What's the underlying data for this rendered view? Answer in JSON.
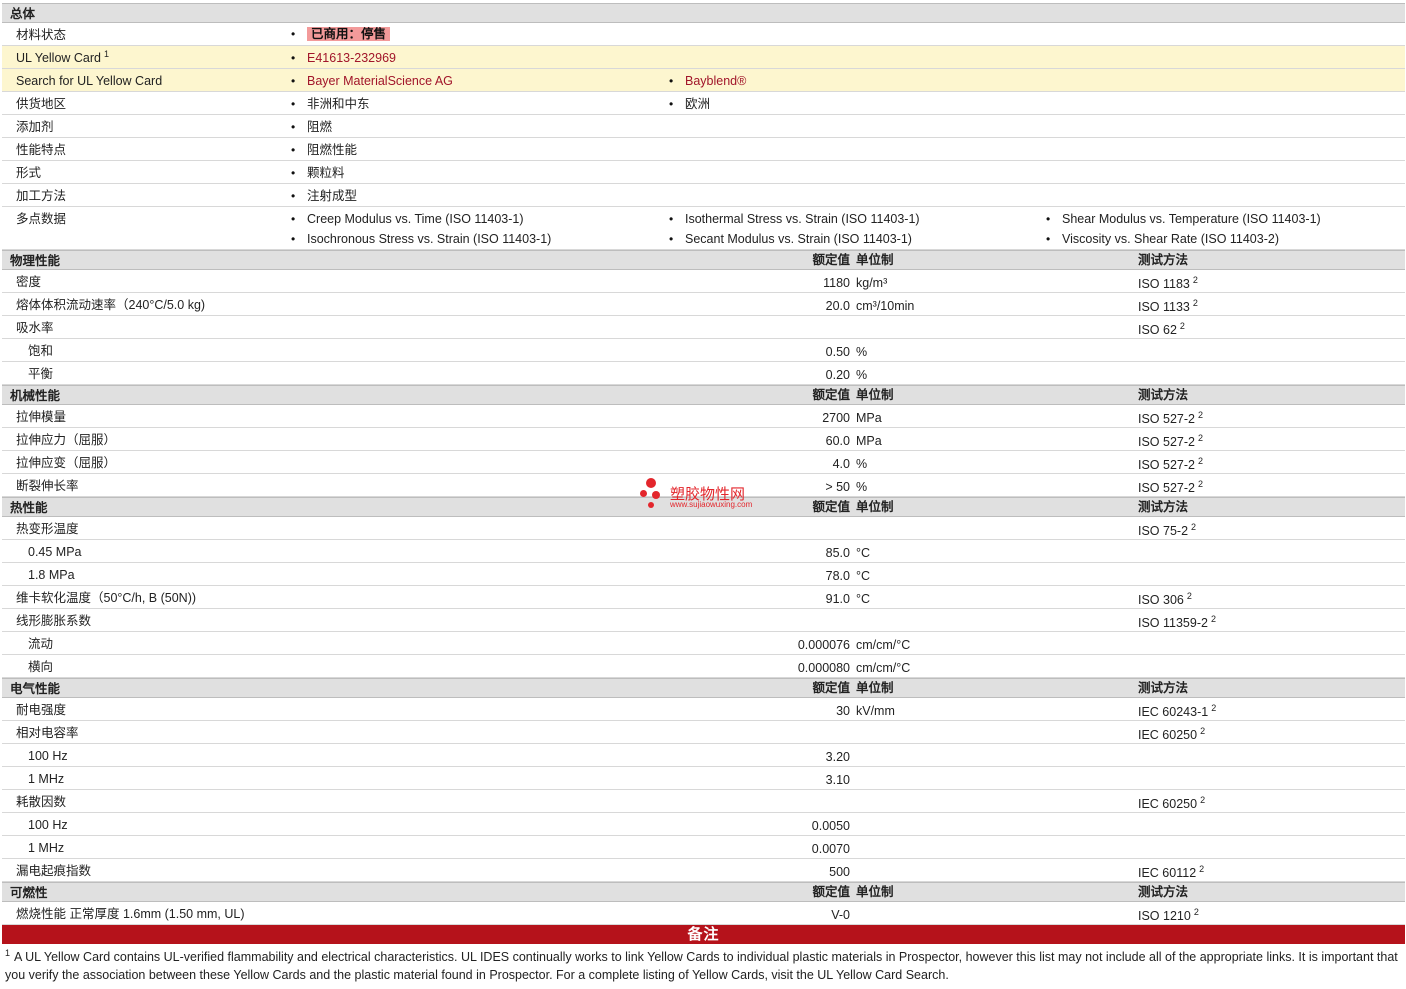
{
  "general": {
    "header": "总体",
    "material_status_label": "材料状态",
    "material_status_value": "已商用：停售",
    "ul_card_label": "UL Yellow Card",
    "ul_card_sup": "1",
    "ul_card_value": "E41613-232969",
    "search_label": "Search for UL Yellow Card",
    "search_links": [
      "Bayer MaterialScience AG",
      "Bayblend®"
    ],
    "supply_label": "供货地区",
    "supply_values": [
      "非洲和中东",
      "欧洲"
    ],
    "additive_label": "添加剂",
    "additive_value": "阻燃",
    "features_label": "性能特点",
    "features_value": "阻燃性能",
    "form_label": "形式",
    "form_value": "颗粒料",
    "processing_label": "加工方法",
    "processing_value": "注射成型",
    "multipoint_label": "多点数据",
    "multipoint_values": [
      "Creep Modulus vs. Time (ISO 11403-1)",
      "Isothermal Stress vs. Strain (ISO 11403-1)",
      "Shear Modulus vs. Temperature (ISO 11403-1)",
      "Isochronous Stress vs. Strain (ISO 11403-1)",
      "Secant Modulus vs. Strain (ISO 11403-1)",
      "Viscosity vs. Shear Rate (ISO 11403-2)"
    ]
  },
  "headers": {
    "value": "额定值",
    "unit": "单位制",
    "test": "测试方法"
  },
  "physical": {
    "title": "物理性能",
    "rows": [
      {
        "label": "密度",
        "value": "1180",
        "unit": "kg/m³",
        "test": "ISO 1183",
        "sup": "2"
      },
      {
        "label": "熔体体积流动速率（240°C/5.0 kg)",
        "value": "20.0",
        "unit": "cm³/10min",
        "test": "ISO 1133",
        "sup": "2"
      },
      {
        "label": "吸水率",
        "value": "",
        "unit": "",
        "test": "ISO 62",
        "sup": "2"
      },
      {
        "label": "饱和",
        "value": "0.50",
        "unit": "%",
        "test": "",
        "sup": ""
      },
      {
        "label": "平衡",
        "value": "0.20",
        "unit": "%",
        "test": "",
        "sup": ""
      }
    ]
  },
  "mechanical": {
    "title": "机械性能",
    "rows": [
      {
        "label": "拉伸模量",
        "value": "2700",
        "unit": "MPa",
        "test": "ISO 527-2",
        "sup": "2"
      },
      {
        "label": "拉伸应力（屈服）",
        "value": "60.0",
        "unit": "MPa",
        "test": "ISO 527-2",
        "sup": "2"
      },
      {
        "label": "拉伸应变（屈服）",
        "value": "4.0",
        "unit": "%",
        "test": "ISO 527-2",
        "sup": "2"
      },
      {
        "label": "断裂伸长率",
        "value": "> 50",
        "unit": "%",
        "test": "ISO 527-2",
        "sup": "2"
      }
    ]
  },
  "thermal": {
    "title": "热性能",
    "rows": [
      {
        "label": "热变形温度",
        "value": "",
        "unit": "",
        "test": "ISO 75-2",
        "sup": "2"
      },
      {
        "label": "0.45 MPa",
        "value": "85.0",
        "unit": "°C",
        "test": "",
        "sup": ""
      },
      {
        "label": "1.8 MPa",
        "value": "78.0",
        "unit": "°C",
        "test": "",
        "sup": ""
      },
      {
        "label": "维卡软化温度（50°C/h, B (50N))",
        "value": "91.0",
        "unit": "°C",
        "test": "ISO 306",
        "sup": "2"
      },
      {
        "label": "线形膨胀系数",
        "value": "",
        "unit": "",
        "test": "ISO 11359-2",
        "sup": "2"
      },
      {
        "label": "流动",
        "value": "0.000076",
        "unit": "cm/cm/°C",
        "test": "",
        "sup": ""
      },
      {
        "label": "横向",
        "value": "0.000080",
        "unit": "cm/cm/°C",
        "test": "",
        "sup": ""
      }
    ]
  },
  "electrical": {
    "title": "电气性能",
    "rows": [
      {
        "label": "耐电强度",
        "value": "30",
        "unit": "kV/mm",
        "test": "IEC 60243-1",
        "sup": "2"
      },
      {
        "label": "相对电容率",
        "value": "",
        "unit": "",
        "test": "IEC 60250",
        "sup": "2"
      },
      {
        "label": "100 Hz",
        "value": "3.20",
        "unit": "",
        "test": "",
        "sup": ""
      },
      {
        "label": "1 MHz",
        "value": "3.10",
        "unit": "",
        "test": "",
        "sup": ""
      },
      {
        "label": "耗散因数",
        "value": "",
        "unit": "",
        "test": "IEC 60250",
        "sup": "2"
      },
      {
        "label": "100 Hz",
        "value": "0.0050",
        "unit": "",
        "test": "",
        "sup": ""
      },
      {
        "label": "1 MHz",
        "value": "0.0070",
        "unit": "",
        "test": "",
        "sup": ""
      },
      {
        "label": "漏电起痕指数",
        "value": "500",
        "unit": "",
        "test": "IEC 60112",
        "sup": "2"
      }
    ]
  },
  "flammability": {
    "title": "可燃性",
    "rows": [
      {
        "label": "燃烧性能  正常厚度  1.6mm (1.50 mm, UL)",
        "value": "V-0",
        "unit": "",
        "test": "ISO 1210",
        "sup": "2"
      }
    ]
  },
  "notes": {
    "title": "备注",
    "footnote_num": "1",
    "footnote_text": "A UL Yellow Card contains UL-verified flammability and electrical characteristics. UL IDES continually works to link Yellow Cards to individual plastic materials in Prospector, however this list may not include all of the appropriate links. It is important that you verify the association between these Yellow Cards and the plastic material found in Prospector. For a complete listing of Yellow Cards, visit the UL Yellow Card Search."
  },
  "watermark": {
    "title": "塑胶物性网",
    "url": "www.sujiaowuxing.com"
  }
}
